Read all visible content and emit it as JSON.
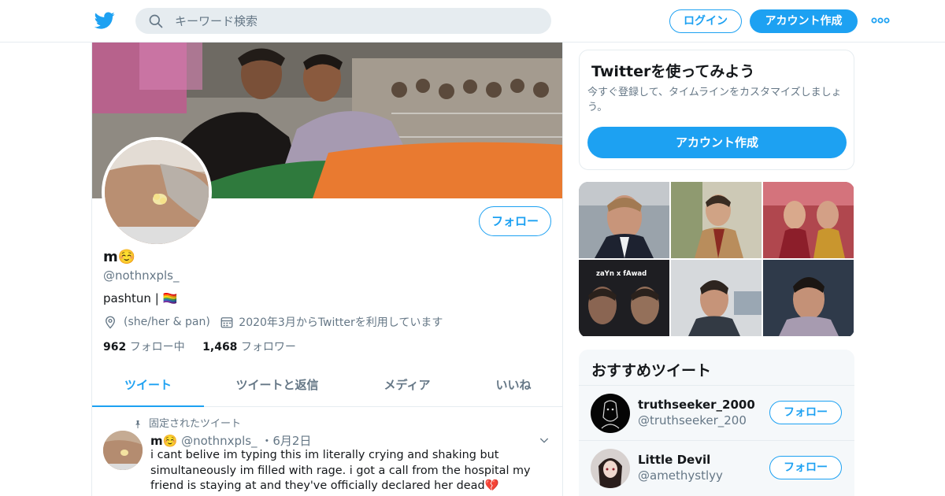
{
  "colors": {
    "accent": "#1da1f2",
    "muted": "#657786",
    "border": "#e6ecf0"
  },
  "header": {
    "logo_icon": "twitter-bird-icon",
    "search_placeholder": "キーワード検索",
    "login_label": "ログイン",
    "signup_label": "アカウント作成",
    "more_icon": "more-dots-icon"
  },
  "profile": {
    "name": "m☺️",
    "handle": "@nothnxpls_",
    "bio": "pashtun | 🏳️‍🌈",
    "location": "(she/her & pan)",
    "joined": "2020年3月からTwitterを利用しています",
    "following_count": "962",
    "following_label": "フォロー中",
    "followers_count": "1,468",
    "followers_label": "フォロワー",
    "follow_label": "フォロー"
  },
  "tabs": [
    {
      "label": "ツイート",
      "active": true
    },
    {
      "label": "ツイートと返信",
      "active": false
    },
    {
      "label": "メディア",
      "active": false
    },
    {
      "label": "いいね",
      "active": false
    }
  ],
  "pinned_tweet": {
    "pinned_label": "固定されたツイート",
    "name": "m☺️",
    "handle": "@nothnxpls_",
    "date": "・6月2日",
    "text": "i cant belive im typing this im literally crying and shaking but simultaneously im filled with rage. i got a call from the hospital my friend is staying at and they've officially declared her dead💔"
  },
  "sidebar": {
    "promo_title": "Twitterを使ってみよう",
    "promo_desc": "今すぐ登録して、タイムラインをカスタマイズしましょう。",
    "promo_button": "アカウント作成",
    "media_captions": [
      "zaYn x fAwad"
    ],
    "recommend_title": "おすすめツイート",
    "recommend": [
      {
        "name": "truthseeker_2000",
        "handle": "@truthseeker_200",
        "follow": "フォロー"
      },
      {
        "name": "Little Devil",
        "handle": "@amethystlyy",
        "follow": "フォロー"
      }
    ]
  }
}
